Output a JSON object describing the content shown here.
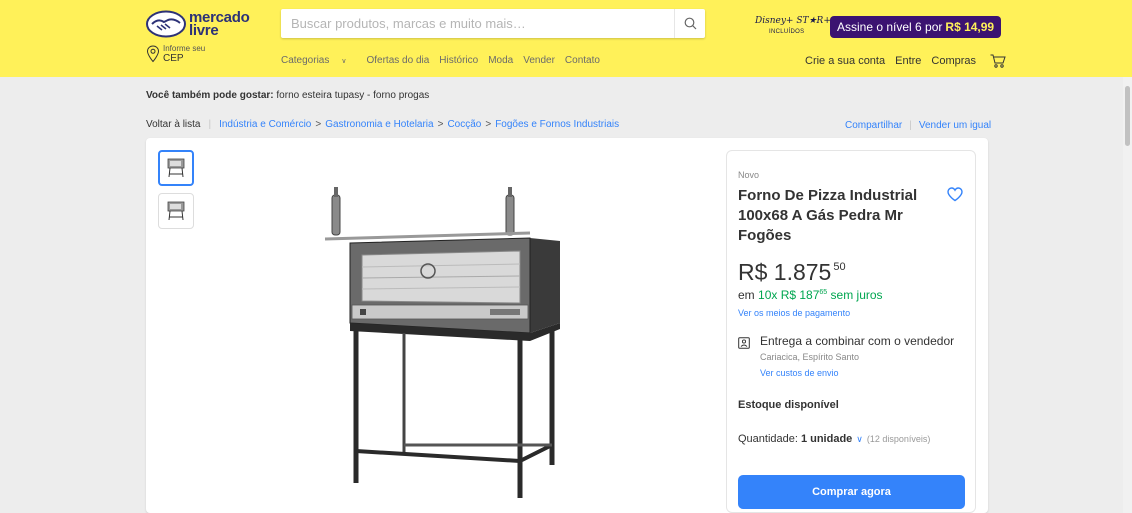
{
  "header": {
    "logo_line1": "mercado",
    "logo_line2": "livre",
    "search_placeholder": "Buscar produtos, marcas e muito mais…",
    "promo_disney": "Disney+ ST★R+",
    "promo_included": "INCLUÍDOS",
    "promo_text": "Assine o nível 6 por",
    "promo_price": "R$ 14,99",
    "location_small": "Informe seu",
    "location_big": "CEP",
    "nav": [
      "Categorias",
      "Ofertas do dia",
      "Histórico",
      "Moda",
      "Vender",
      "Contato"
    ],
    "user_nav": [
      "Crie a sua conta",
      "Entre",
      "Compras"
    ]
  },
  "suggestions": {
    "label": "Você também pode gostar:",
    "text": "forno esteira tupasy - forno progas"
  },
  "breadcrumb": {
    "back": "Voltar à lista",
    "items": [
      "Indústria e Comércio",
      "Gastronomia e Hotelaria",
      "Cocção",
      "Fogões e Fornos Industriais"
    ],
    "share": "Compartilhar",
    "sell_same": "Vender um igual"
  },
  "product": {
    "condition": "Novo",
    "title": "Forno De Pizza Industrial 100x68 A Gás Pedra Mr Fogões",
    "price_main": "R$ 1.875",
    "price_cents": "50",
    "installments_prefix": "em",
    "installments": "10x R$ 187",
    "installments_cents": "65",
    "installments_suffix": "sem juros",
    "payment_link": "Ver os meios de pagamento",
    "shipping": "Entrega a combinar com o vendedor",
    "shipping_city": "Cariacica, Espírito Santo",
    "shipping_link": "Ver custos de envio",
    "stock": "Estoque disponível",
    "quantity_label": "Quantidade:",
    "quantity_value": "1 unidade",
    "quantity_available": "(12 disponíveis)",
    "buy_button": "Comprar agora"
  },
  "colors": {
    "header_bg": "#fff159",
    "accent_blue": "#3483fa",
    "green": "#00a650",
    "promo_bg": "#3b1371"
  }
}
